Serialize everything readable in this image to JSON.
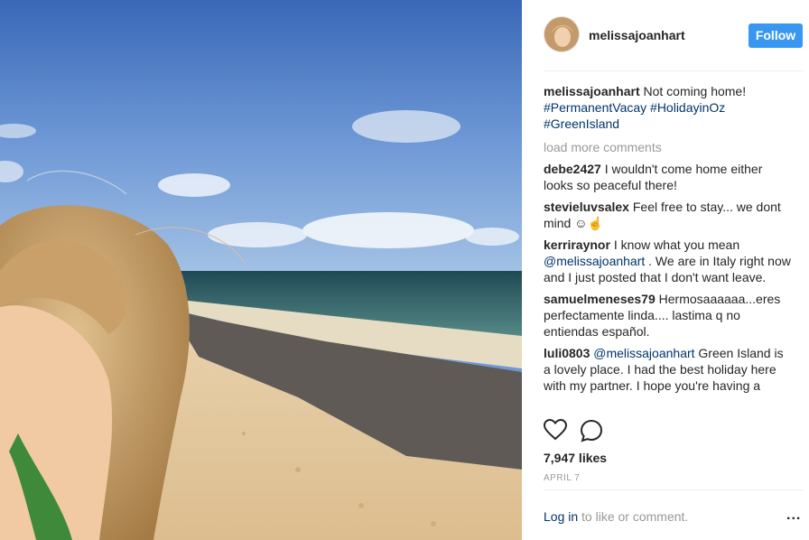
{
  "post": {
    "username": "melissajoanhart",
    "follow_label": "Follow",
    "caption_text": "Not coming home!",
    "hashtags": [
      "#PermanentVacay",
      "#HolidayinOz",
      "#GreenIsland"
    ],
    "load_more": "load more comments",
    "likes": "7,947 likes",
    "date": "APRIL 7",
    "login_link": "Log in",
    "login_rest": "to like or comment.",
    "more_label": "..."
  },
  "comments": [
    {
      "user": "debe2427",
      "text": "I wouldn't come home either looks so peaceful there!"
    },
    {
      "user": "stevieluvsalex",
      "text": "Feel free to stay... we dont mind",
      "emoji": "☺☝"
    },
    {
      "user": "kerriraynor",
      "pre": "I know what you mean",
      "mention": "@melissajoanhart",
      "text": ". We are in Italy right now and I just posted that I don't want leave."
    },
    {
      "user": "samuelmeneses79",
      "text": "Hermosaaaaaa...eres perfectamente linda.... lastima q no entiendas español."
    },
    {
      "user": "luli0803",
      "mention": "@melissajoanhart",
      "text": "Green Island is a lovely place. I had the best holiday here with my partner. I hope you're having a"
    }
  ],
  "icons": {
    "heart": "heart-icon",
    "comment": "comment-bubble-icon"
  }
}
